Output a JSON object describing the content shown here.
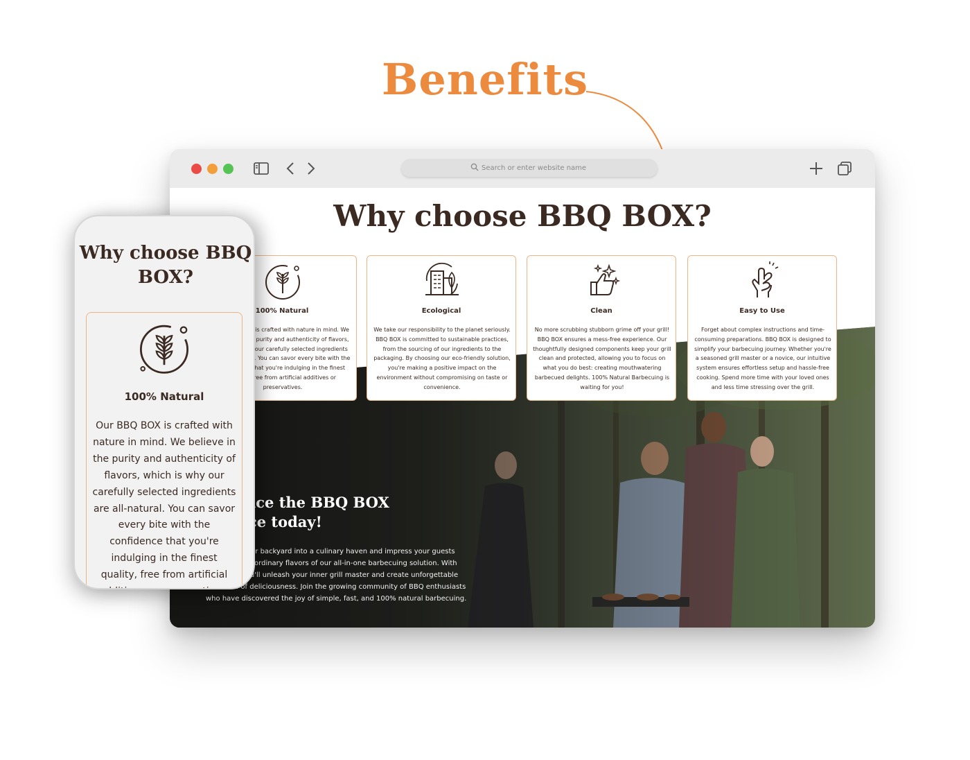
{
  "annotation": {
    "heading": "Benefits"
  },
  "browser": {
    "address_placeholder": "Search or enter website name"
  },
  "site": {
    "title": "Why choose BBQ BOX?",
    "cards": [
      {
        "icon": "wheat-icon",
        "title": "100% Natural",
        "text": "Our BBQ BOX is crafted with nature in mind. We believe in the purity and authenticity of flavors, which is why our carefully selected ingredients are all-natural. You can savor every bite with the confidence that you're indulging in the finest quality, free from artificial additives or preservatives."
      },
      {
        "icon": "eco-building-icon",
        "title": "Ecological",
        "text": "We take our responsibility to the planet seriously. BBQ BOX is committed to sustainable practices, from the sourcing of our ingredients to the packaging. By choosing our eco-friendly solution, you're making a positive impact on the environment without compromising on taste or convenience."
      },
      {
        "icon": "thumbs-up-sparkle-icon",
        "title": "Clean",
        "text": "No more scrubbing stubborn grime off your grill! BBQ BOX ensures a mess-free experience. Our thoughtfully designed components keep your grill clean and protected, allowing you to focus on what you do best: creating mouthwatering barbecued delights. 100% Natural Barbecuing is waiting for you!"
      },
      {
        "icon": "fingers-snap-icon",
        "title": "Easy to Use",
        "text": "Forget about complex instructions and time-consuming preparations. BBQ BOX is designed to simplify your barbecuing journey. Whether you're a seasoned grill master or a novice, our intuitive system ensures effortless setup and hassle-free cooking. Spend more time with your loved ones and less time stressing over the grill."
      }
    ],
    "hero": {
      "title": "Experience the BBQ BOX difference today!",
      "text": "Transform your backyard into a culinary haven and impress your guests with the extraordinary flavors of our all-in-one barbecuing solution. With BBQ BOX, you'll unleash your inner grill master and create unforgettable moments of deliciousness. Join the growing community of BBQ enthusiasts who have discovered the joy of simple, fast, and 100% natural barbecuing."
    }
  },
  "phone": {
    "title": "Why choose BBQ BOX?",
    "card": {
      "icon": "wheat-icon",
      "title": "100% Natural",
      "text": "Our BBQ BOX is crafted with nature in mind. We believe in the purity and authenticity of flavors, which is why our carefully selected ingredients are all-natural. You can savor every bite with the confidence that you're indulging in the finest quality, free from artificial additives or preservatives."
    }
  },
  "colors": {
    "accent": "#ec8a3e",
    "text": "#3b2a22",
    "card_border": "#efb486"
  }
}
